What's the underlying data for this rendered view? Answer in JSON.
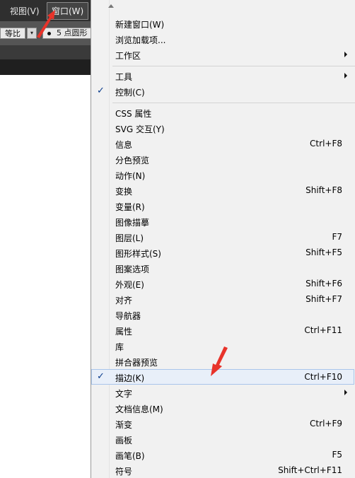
{
  "menubar": {
    "view_label": "视图(V)",
    "window_label": "窗口(W)"
  },
  "controlbar": {
    "ratio_label": "等比",
    "ratio_dropdown_glyph": "▾",
    "brush_label": "5 点圆形"
  },
  "menu": {
    "items": [
      {
        "label": "新建窗口(W)",
        "shortcut": ""
      },
      {
        "label": "浏览加载项...",
        "shortcut": ""
      },
      {
        "label": "工作区",
        "shortcut": "",
        "submenu": true
      },
      {
        "label": "工具",
        "shortcut": "",
        "submenu": true
      },
      {
        "label": "控制(C)",
        "shortcut": "",
        "checked": true
      },
      {
        "label": "CSS 属性",
        "shortcut": ""
      },
      {
        "label": "SVG 交互(Y)",
        "shortcut": ""
      },
      {
        "label": "信息",
        "shortcut": "Ctrl+F8"
      },
      {
        "label": "分色预览",
        "shortcut": ""
      },
      {
        "label": "动作(N)",
        "shortcut": ""
      },
      {
        "label": "变换",
        "shortcut": "Shift+F8"
      },
      {
        "label": "变量(R)",
        "shortcut": ""
      },
      {
        "label": "图像描摹",
        "shortcut": ""
      },
      {
        "label": "图层(L)",
        "shortcut": "F7"
      },
      {
        "label": "图形样式(S)",
        "shortcut": "Shift+F5"
      },
      {
        "label": "图案选项",
        "shortcut": ""
      },
      {
        "label": "外观(E)",
        "shortcut": "Shift+F6"
      },
      {
        "label": "对齐",
        "shortcut": "Shift+F7"
      },
      {
        "label": "导航器",
        "shortcut": ""
      },
      {
        "label": "属性",
        "shortcut": "Ctrl+F11"
      },
      {
        "label": "库",
        "shortcut": ""
      },
      {
        "label": "拼合器预览",
        "shortcut": ""
      },
      {
        "label": "描边(K)",
        "shortcut": "Ctrl+F10",
        "checked": true,
        "highlighted": true
      },
      {
        "label": "文字",
        "shortcut": "",
        "submenu": true
      },
      {
        "label": "文档信息(M)",
        "shortcut": ""
      },
      {
        "label": "渐变",
        "shortcut": "Ctrl+F9"
      },
      {
        "label": "画板",
        "shortcut": ""
      },
      {
        "label": "画笔(B)",
        "shortcut": "F5"
      },
      {
        "label": "符号",
        "shortcut": "Shift+Ctrl+F11"
      }
    ],
    "check_glyph": "✓"
  },
  "colors": {
    "annotation_arrow": "#e8332a",
    "highlight_bg": "#e8eff9",
    "highlight_border": "#a9c5ea"
  }
}
